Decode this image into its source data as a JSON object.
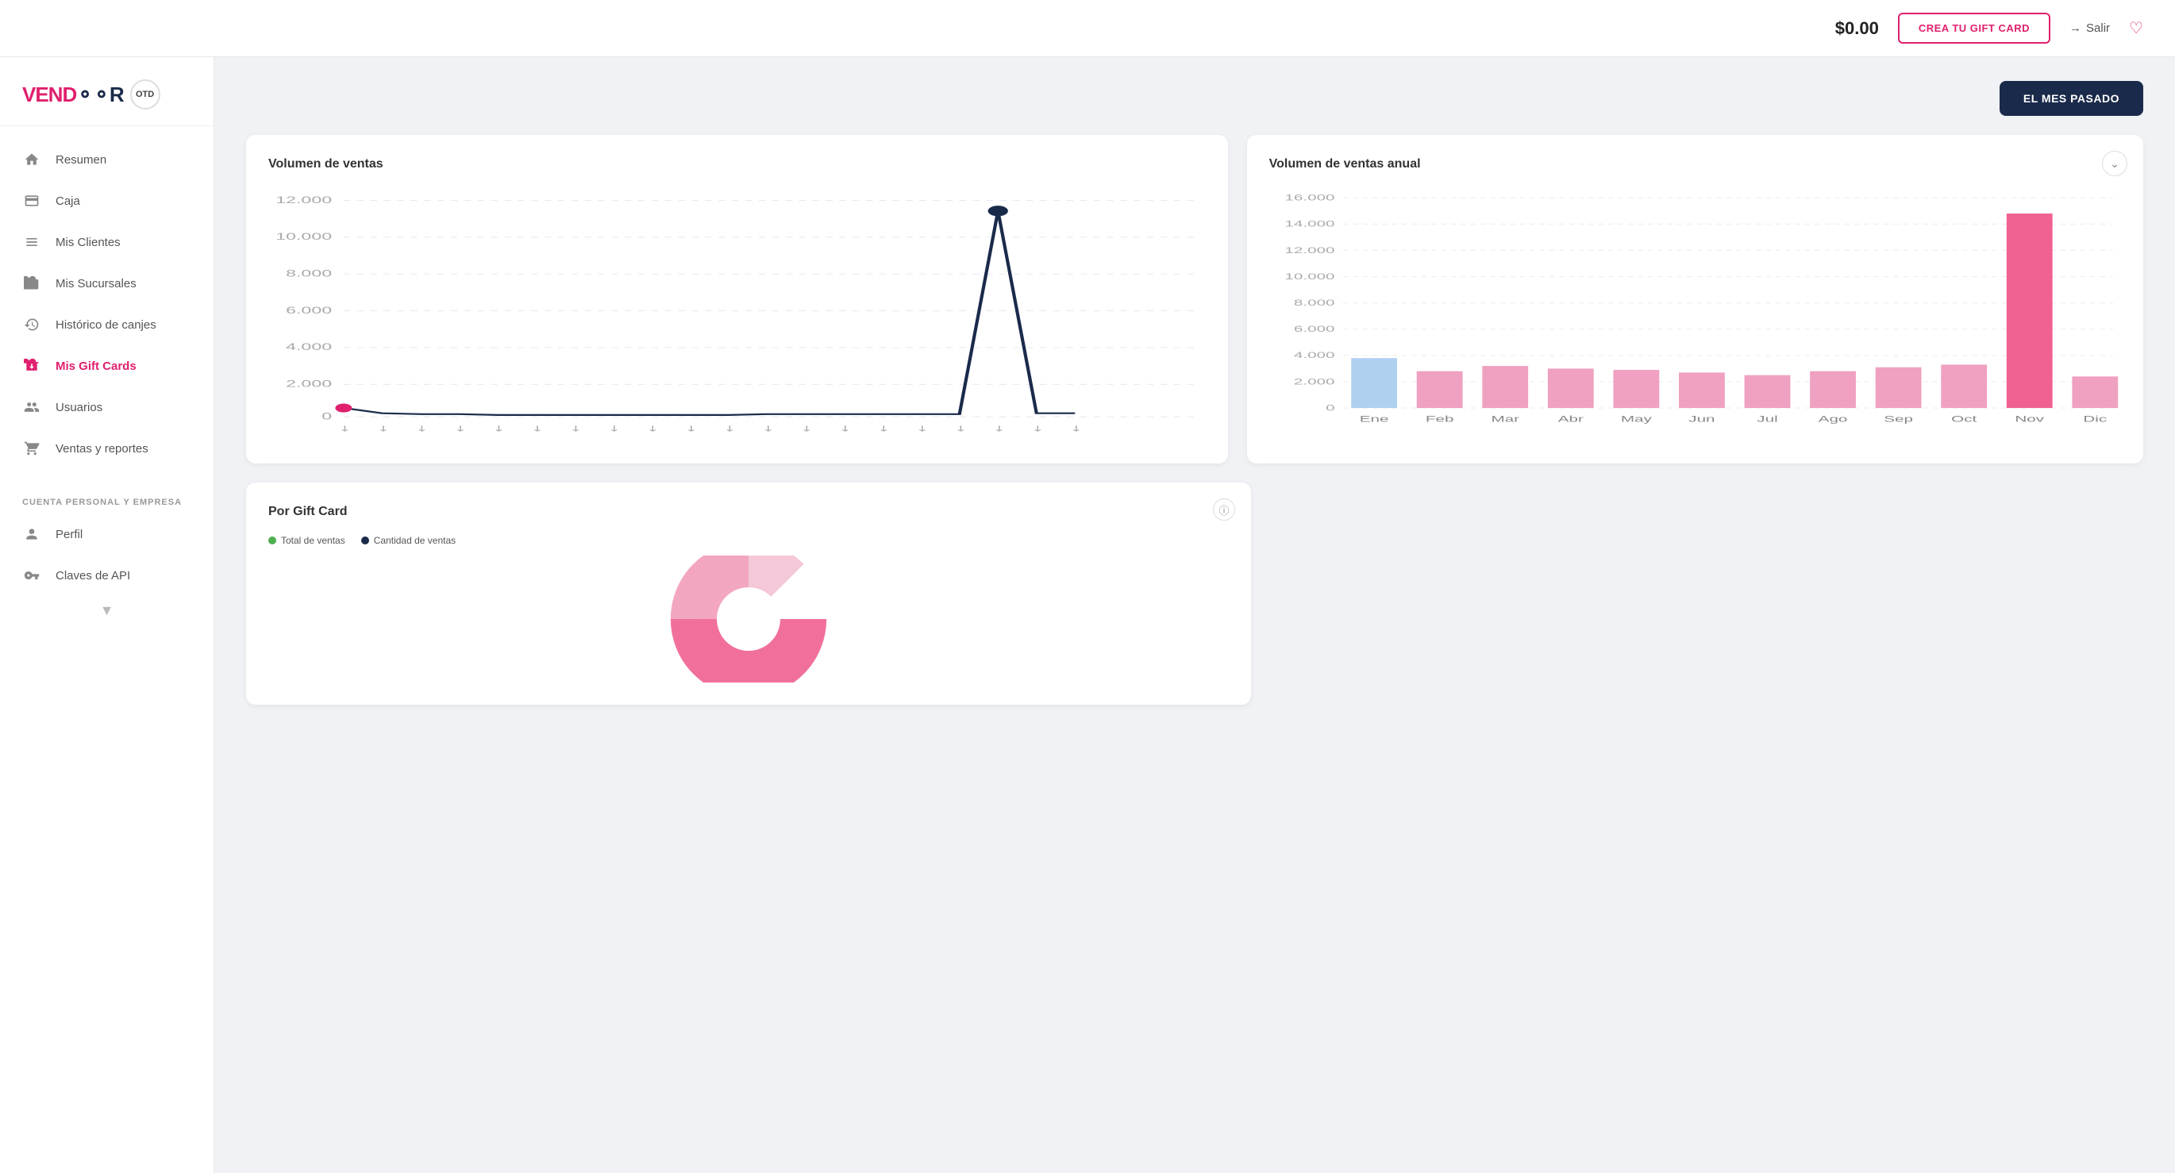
{
  "header": {
    "balance": "$0.00",
    "create_gift_label": "CREA TU GIFT CARD",
    "salir_label": "Salir",
    "salir_icon": "→"
  },
  "sidebar": {
    "logo_vendor": "VEND",
    "logo_r": "R",
    "logo_otd": "OTD",
    "nav_items": [
      {
        "id": "resumen",
        "label": "Resumen",
        "icon": "home"
      },
      {
        "id": "caja",
        "label": "Caja",
        "icon": "cash"
      },
      {
        "id": "mis-clientes",
        "label": "Mis Clientes",
        "icon": "clients"
      },
      {
        "id": "mis-sucursales",
        "label": "Mis Sucursales",
        "icon": "branches"
      },
      {
        "id": "historico-canjes",
        "label": "Histórico de canjes",
        "icon": "history"
      },
      {
        "id": "mis-gift-cards",
        "label": "Mis Gift Cards",
        "icon": "gift",
        "active": true
      },
      {
        "id": "usuarios",
        "label": "Usuarios",
        "icon": "users"
      },
      {
        "id": "ventas-reportes",
        "label": "Ventas y reportes",
        "icon": "cart"
      }
    ],
    "section_label": "CUENTA PERSONAL Y EMPRESA",
    "personal_items": [
      {
        "id": "perfil",
        "label": "Perfil",
        "icon": "person"
      },
      {
        "id": "claves-api",
        "label": "Claves de API",
        "icon": "api"
      }
    ]
  },
  "main": {
    "filter_button": "EL MES PASADO",
    "chart_ventas": {
      "title": "Volumen de ventas",
      "y_labels": [
        "12.000",
        "10.000",
        "8.000",
        "6.000",
        "4.000",
        "2.000",
        "0"
      ],
      "x_labels": [
        "",
        "",
        "",
        "",
        "",
        "",
        "",
        "",
        "",
        "",
        "",
        "",
        "",
        "",
        "",
        "",
        "",
        "",
        "",
        ""
      ],
      "peak_value": 11400,
      "base_value": 500,
      "accent_color": "#1a2a4a",
      "start_color": "#e0206e"
    },
    "chart_anual": {
      "title": "Volumen de ventas anual",
      "y_labels": [
        "16.000",
        "14.000",
        "12.000",
        "10.000",
        "8.000",
        "6.000",
        "4.000",
        "2.000",
        "0"
      ],
      "months": [
        "Ene",
        "Feb",
        "Mar",
        "Abr",
        "May",
        "Jun",
        "Jul",
        "Ago",
        "Sep",
        "Oct",
        "Nov",
        "Dic"
      ],
      "values": [
        3800,
        2800,
        3200,
        3000,
        2900,
        2700,
        2500,
        2800,
        3100,
        3300,
        14800,
        2400
      ],
      "highlight_month_index": 0,
      "highlight_color": "#b0d0f0",
      "bar_color": "#f0a0c0",
      "peak_color": "#f06090"
    },
    "chart_gift_card": {
      "title": "Por Gift Card",
      "legend": [
        {
          "label": "Total de ventas",
          "color": "#4caf50"
        },
        {
          "label": "Cantidad de ventas",
          "color": "#1a2a4a"
        }
      ],
      "pie_color": "#f06090"
    }
  }
}
